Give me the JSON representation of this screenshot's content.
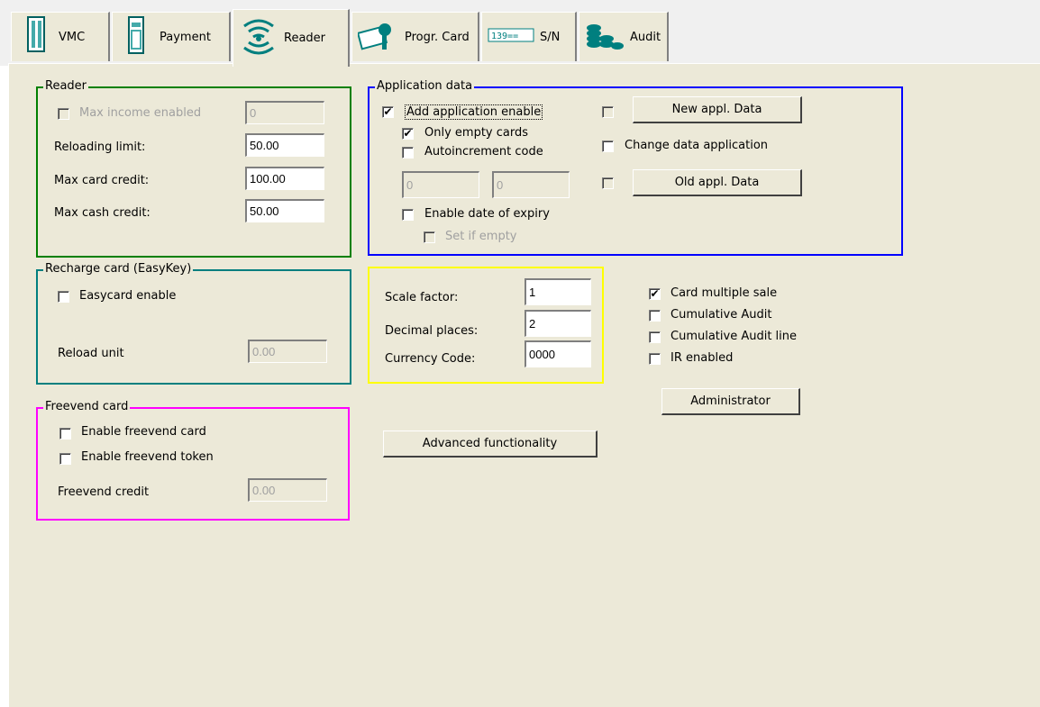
{
  "tabs": [
    {
      "label": "VMC",
      "icon": "vending-machine-icon"
    },
    {
      "label": "Payment",
      "icon": "coin-mech-icon"
    },
    {
      "label": "Reader",
      "icon": "wireless-reader-icon"
    },
    {
      "label": "Progr. Card",
      "icon": "card-key-icon"
    },
    {
      "label": "S/N",
      "icon": "serial-number-icon"
    },
    {
      "label": "Audit",
      "icon": "coins-icon"
    }
  ],
  "colors": {
    "reader": "#008000",
    "recharge": "#007f7f",
    "freevend": "#ff00ff",
    "application": "#0000ff",
    "scale": "#ffff00"
  },
  "reader": {
    "title": "Reader",
    "max_income_label": "Max income enabled",
    "max_income_value": "0",
    "reloading_limit_label": "Reloading limit:",
    "reloading_limit_value": "50.00",
    "max_card_credit_label": "Max card credit:",
    "max_card_credit_value": "100.00",
    "max_cash_credit_label": "Max cash credit:",
    "max_cash_credit_value": "50.00"
  },
  "recharge": {
    "title": "Recharge card (EasyKey)",
    "easycard_label": "Easycard enable",
    "reload_unit_label": "Reload unit",
    "reload_unit_value": "0.00"
  },
  "freevend": {
    "title": "Freevend card",
    "enable_card_label": "Enable freevend card",
    "enable_token_label": "Enable freevend token",
    "credit_label": "Freevend credit",
    "credit_value": "0.00"
  },
  "application": {
    "title": "Application data",
    "add_enable_label": "Add application enable",
    "add_enable_checked": "✔",
    "only_empty_label": "Only empty cards",
    "only_empty_checked": "✔",
    "autoincrement_label": "Autoincrement code",
    "code_a": "0",
    "code_b": "0",
    "expiry_label": "Enable date of expiry",
    "set_if_empty_label": "Set if empty",
    "new_button": "New appl. Data",
    "change_label": "Change data application",
    "old_button": "Old appl. Data"
  },
  "scale": {
    "scale_factor_label": "Scale factor:",
    "scale_factor_value": "1",
    "decimal_label": "Decimal places:",
    "decimal_value": "2",
    "currency_label": "Currency Code:",
    "currency_value": "0000"
  },
  "options": {
    "card_multiple_label": "Card multiple sale",
    "card_multiple_checked": "✔",
    "cumulative_audit_label": "Cumulative Audit",
    "cumulative_line_label": "Cumulative Audit line",
    "ir_label": "IR enabled"
  },
  "buttons": {
    "administrator": "Administrator",
    "advanced": "Advanced functionality"
  }
}
